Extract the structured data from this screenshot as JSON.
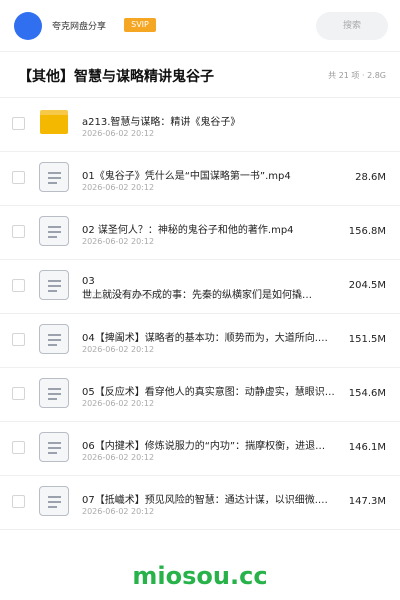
{
  "topbar": {
    "share_name": "夸克网盘分享",
    "badge": "SVIP",
    "search_placeholder": "搜索"
  },
  "header": {
    "title": "【其他】智慧与谋略精讲鬼谷子",
    "meta": "共 21 项 · 2.8G"
  },
  "files": [
    {
      "type": "folder",
      "name": "a213.智慧与谋略：精讲《鬼谷子》",
      "date": "2026-06-02 20:12",
      "size": ""
    },
    {
      "type": "video",
      "name": "01《鬼谷子》凭什么是“中国谋略第一书”.mp4",
      "date": "2026-06-02 20:12",
      "size": "28.6M"
    },
    {
      "type": "video",
      "name": "02 谋圣何人？：神秘的鬼谷子和他的著作.mp4",
      "date": "2026-06-02 20:12",
      "size": "156.8M"
    },
    {
      "type": "video",
      "name": "03",
      "name_line2": "世上就没有办不成的事：先秦的纵横家们是如何撬…",
      "date": "2026-06-02 20:12",
      "size": "204.5M"
    },
    {
      "type": "video",
      "name": "04【捭阖术】谋略者的基本功：顺势而为，大道所向.…",
      "date": "2026-06-02 20:12",
      "size": "151.5M"
    },
    {
      "type": "video",
      "name": "05【反应术】看穿他人的真实意图：动静虚实，慧眼识…",
      "date": "2026-06-02 20:12",
      "size": "154.6M"
    },
    {
      "type": "video",
      "name": "06【内揵术】修炼说服力的“内功”：揣摩权衡，进退…",
      "date": "2026-06-02 20:12",
      "size": "146.1M"
    },
    {
      "type": "video",
      "name": "07【抵巇术】预见风险的智慧：通达计谋，以识细微.…",
      "date": "2026-06-02 20:12",
      "size": "147.3M"
    }
  ],
  "footer": {
    "brand": "miosou.cc"
  },
  "colors": {
    "avatar": "#2f6ff0",
    "svip": "#f5a623",
    "folder": "#f5b800",
    "brand": "#27b24a"
  }
}
